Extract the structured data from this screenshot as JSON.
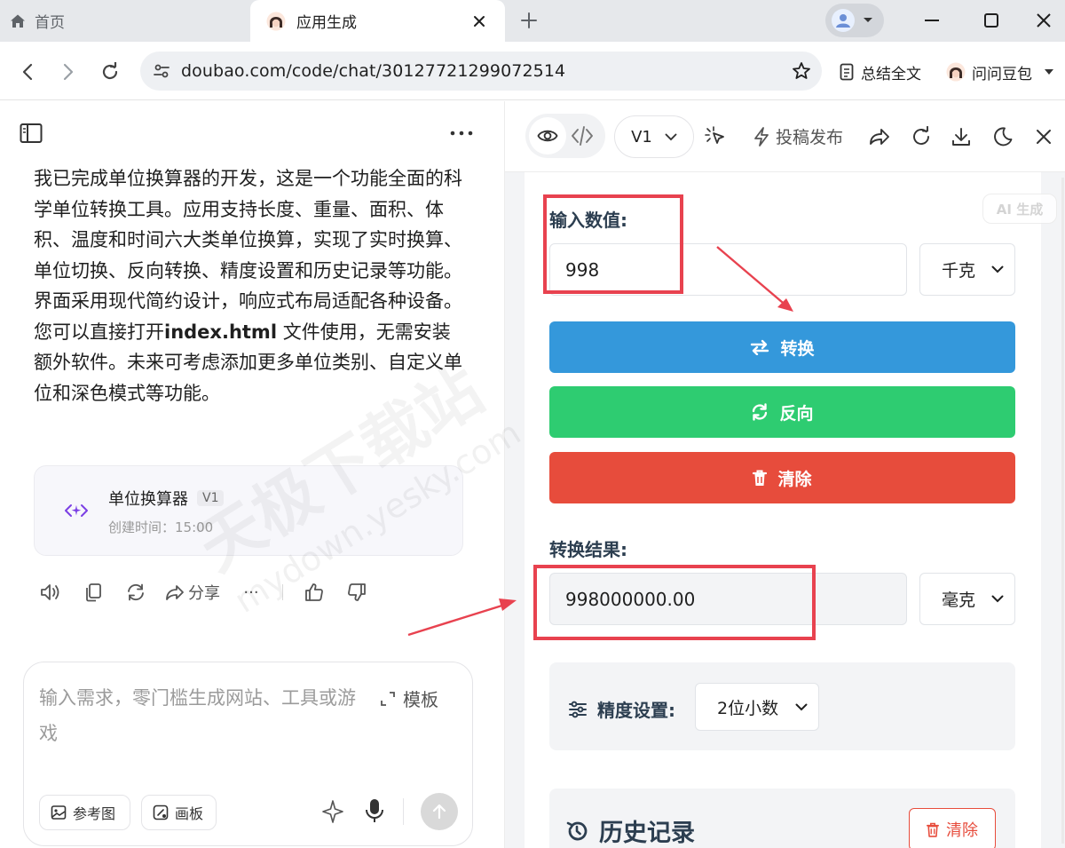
{
  "browser": {
    "tabs": [
      {
        "label": "首页",
        "icon": "home-icon"
      },
      {
        "label": "应用生成",
        "icon": "doubao-avatar"
      }
    ],
    "url": "doubao.com/code/chat/30127721299072514",
    "extensions": {
      "summary_label": "总结全文",
      "ask_label": "问问豆包"
    }
  },
  "chat": {
    "message_part1": "我已完成单位换算器的开发，这是一个功能全面的科学单位转换工具。应用支持长度、重量、面积、体积、温度和时间六大类单位换算，实现了实时换算、单位切换、反向转换、精度设置和历史记录等功能。界面采用现代简约设计，响应式布局适配各种设备。您可以直接打开",
    "message_bold": "index.html",
    "message_part2": " 文件使用，无需安装额外软件。未来可考虑添加更多单位类别、自定义单位和深色模式等功能。",
    "artifact": {
      "title": "单位换算器",
      "version": "V1",
      "created": "创建时间：15:00"
    },
    "actions": {
      "share_label": "分享",
      "more_label": "···"
    },
    "composer": {
      "placeholder": "输入需求，零门槛生成网站、工具或游戏",
      "template_label": "模板",
      "ref_image_label": "参考图",
      "canvas_label": "画板"
    }
  },
  "preview": {
    "version_label": "V1",
    "publish_label": "投稿发布",
    "ai_badge": "AI 生成",
    "input_label": "输入数值:",
    "input_value": "998",
    "from_unit": "千克",
    "convert_label": "转换",
    "reverse_label": "反向",
    "clear_label": "清除",
    "result_label": "转换结果:",
    "result_value": "998000000.00",
    "to_unit": "毫克",
    "precision_label": "精度设置:",
    "precision_value": "2位小数",
    "history_title": "历史记录",
    "history_clear_label": "清除",
    "colors": {
      "convert": "#3498db",
      "reverse": "#2ecc71",
      "clear": "#e74c3c",
      "heading": "#2c3e50",
      "annotation": "#e8424f"
    }
  },
  "watermark": {
    "text": "天极下载站",
    "url": "mydown.yesky.com"
  }
}
